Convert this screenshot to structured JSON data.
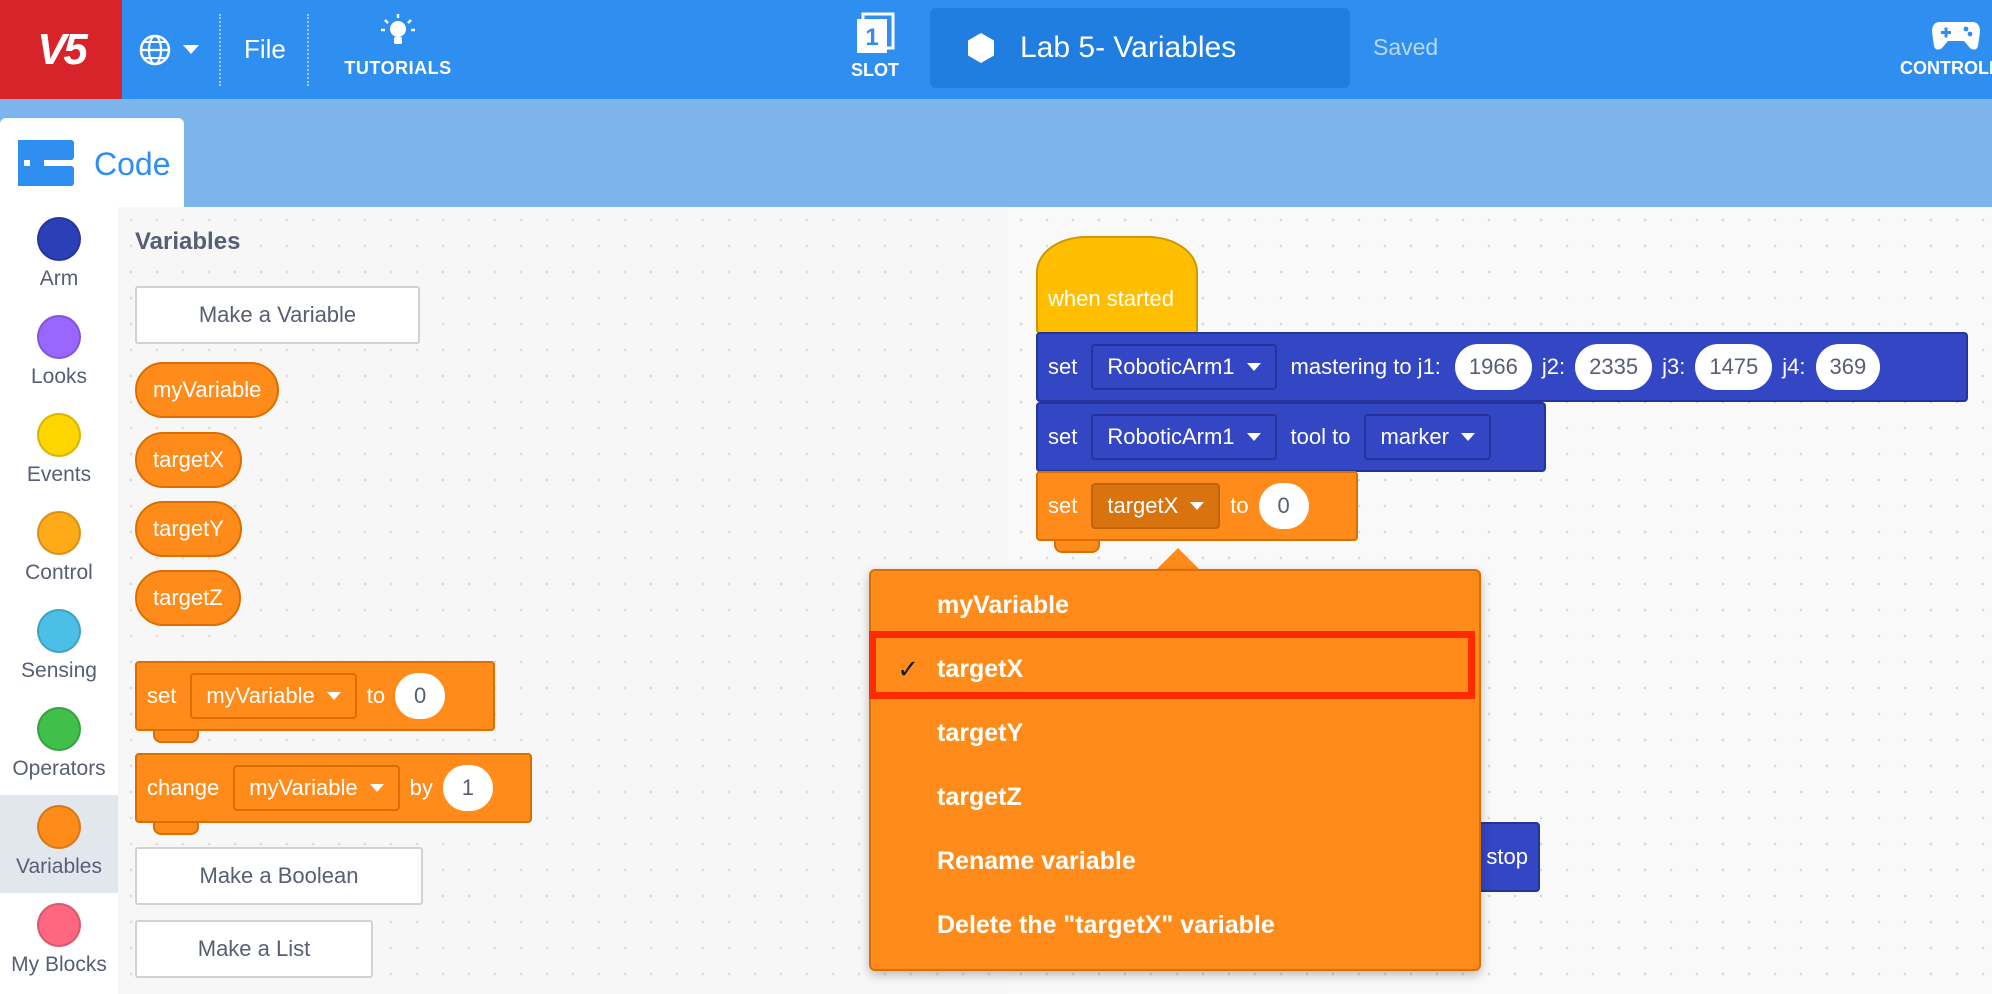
{
  "topbar": {
    "logo_text": "V5",
    "file_label": "File",
    "tutorials_label": "TUTORIALS",
    "slot_number": "1",
    "slot_label": "SLOT",
    "project_name": "Lab 5- Variables",
    "saved_status": "Saved",
    "controller_label": "CONTROLLE"
  },
  "code_tab": {
    "label": "Code"
  },
  "categories": [
    {
      "label": "Arm",
      "color": "#2b3fb8"
    },
    {
      "label": "Looks",
      "color": "#9966ff"
    },
    {
      "label": "Events",
      "color": "#ffd500"
    },
    {
      "label": "Control",
      "color": "#ffab19"
    },
    {
      "label": "Sensing",
      "color": "#4cbfe6"
    },
    {
      "label": "Operators",
      "color": "#40bf4a"
    },
    {
      "label": "Variables",
      "color": "#ff8c1a"
    },
    {
      "label": "My Blocks",
      "color": "#ff6680"
    }
  ],
  "flyout": {
    "title": "Variables",
    "make_variable": "Make a Variable",
    "variables": [
      "myVariable",
      "targetX",
      "targetY",
      "targetZ"
    ],
    "set_block": {
      "kw": "set",
      "var": "myVariable",
      "to": "to",
      "value": "0"
    },
    "change_block": {
      "kw": "change",
      "var": "myVariable",
      "by": "by",
      "value": "1"
    },
    "make_boolean": "Make a Boolean",
    "make_list": "Make a List"
  },
  "script": {
    "hat": "when started",
    "mastering": {
      "kw": "set",
      "device": "RoboticArm1",
      "text": "mastering to j1:",
      "j1": "1966",
      "j2_label": "j2:",
      "j2": "2335",
      "j3_label": "j3:",
      "j3": "1475",
      "j4_label": "j4:",
      "j4": "369"
    },
    "tool": {
      "kw": "set",
      "device": "RoboticArm1",
      "text": "tool to",
      "tool": "marker"
    },
    "setvar": {
      "kw": "set",
      "var": "targetX",
      "to": "to",
      "value": "0"
    },
    "hidden_block_tail": "stop"
  },
  "dropdown": {
    "items": [
      {
        "label": "myVariable",
        "checked": ""
      },
      {
        "label": "targetX",
        "checked": "✓"
      },
      {
        "label": "targetY",
        "checked": ""
      },
      {
        "label": "targetZ",
        "checked": ""
      },
      {
        "label": "Rename variable",
        "checked": ""
      },
      {
        "label": "Delete the \"targetX\" variable",
        "checked": ""
      }
    ]
  }
}
